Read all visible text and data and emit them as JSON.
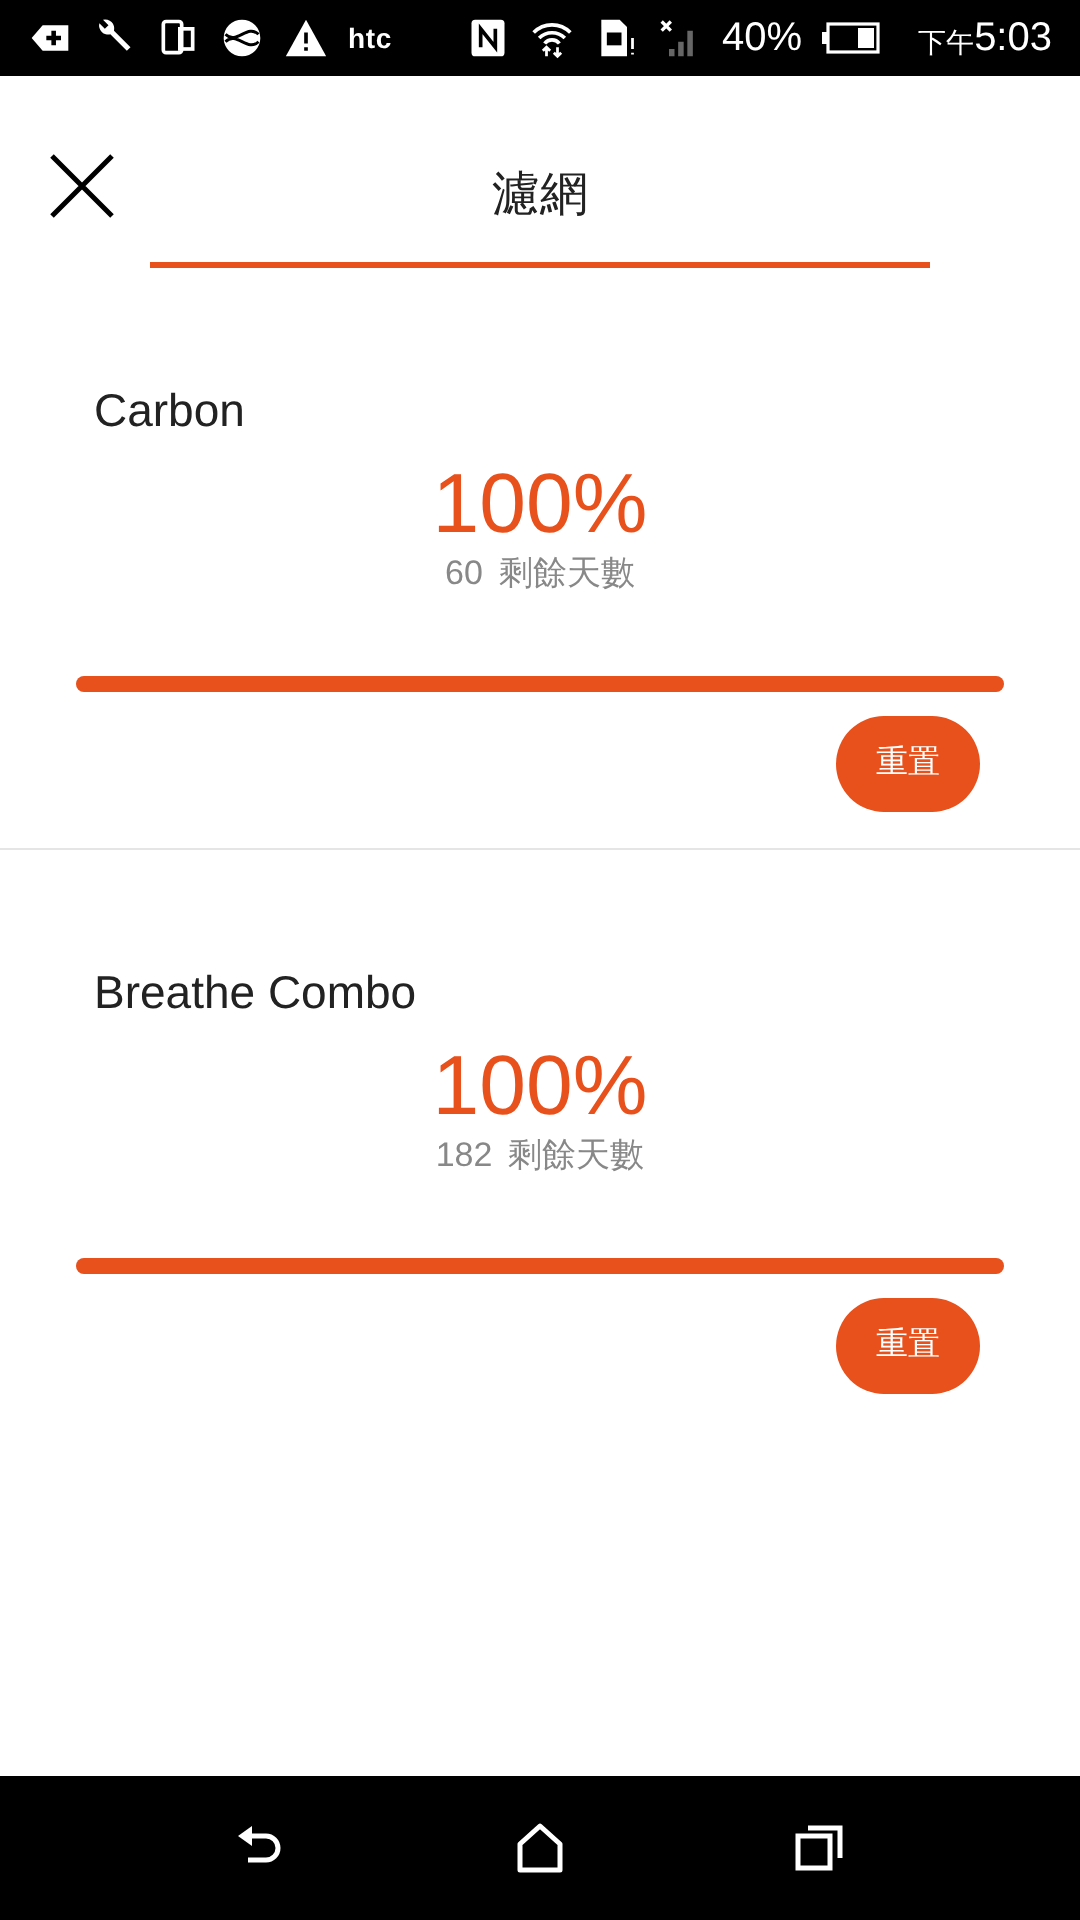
{
  "status_bar": {
    "brand": "htc",
    "battery": "40%",
    "period": "下午",
    "time": "5:03"
  },
  "header": {
    "title": "濾網"
  },
  "filters": [
    {
      "name": "Carbon",
      "percent": "100%",
      "days": "60",
      "days_label": "剩餘天數",
      "level": 1,
      "button": "重置"
    },
    {
      "name": "Breathe Combo",
      "percent": "100%",
      "days": "182",
      "days_label": "剩餘天數",
      "level": 1,
      "button": "重置"
    }
  ]
}
